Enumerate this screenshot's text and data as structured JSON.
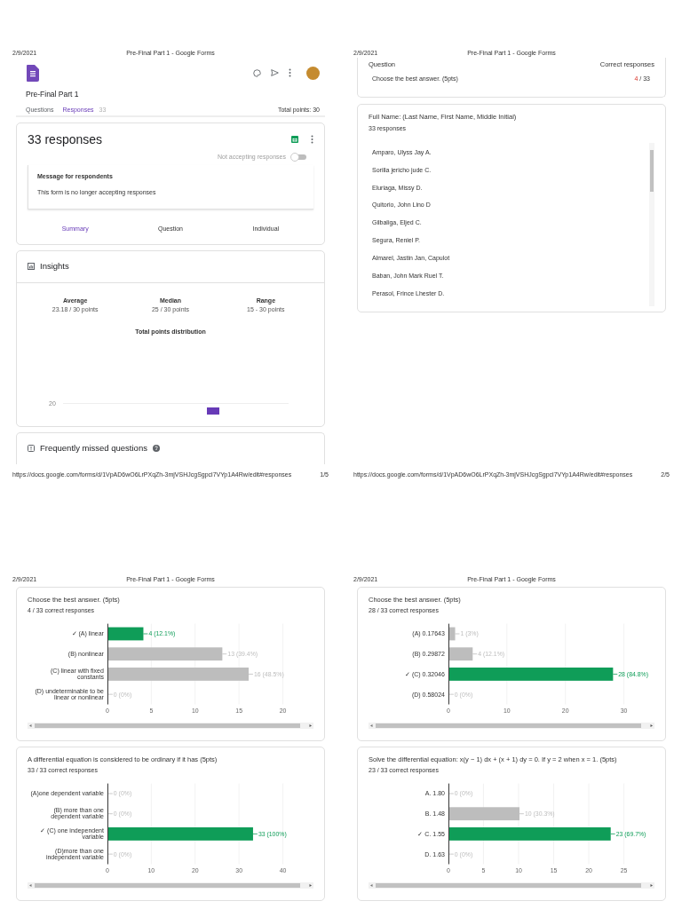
{
  "pages": [
    {
      "kind": "summary",
      "header": {
        "date": "2/9/2021",
        "title": "Pre-Final Part 1 - Google Forms"
      },
      "footer": {
        "url": "https://docs.google.com/forms/d/1VpAD6wO6LrPXqZh-3mjVSHJcgSgpcl7VYp1A4Rw/edit#responses",
        "page": "1/5"
      },
      "form_title": "Pre-Final Part 1",
      "tabs": [
        {
          "label": "Questions",
          "selected": false
        },
        {
          "label": "Responses",
          "selected": true,
          "count": "33"
        }
      ],
      "total_points": "Total points: 30",
      "responses_card": {
        "title": "33 responses",
        "accepting_label": "Not accepting responses",
        "accepting": false,
        "message_title": "Message for respondents",
        "message": "This form is no longer accepting responses",
        "view_tabs": [
          {
            "label": "Summary",
            "selected": true
          },
          {
            "label": "Question",
            "selected": false
          },
          {
            "label": "Individual",
            "selected": false
          }
        ]
      },
      "insights": {
        "title": "Insights",
        "stats": [
          {
            "label": "Average",
            "value": "23.18 / 30 points"
          },
          {
            "label": "Median",
            "value": "25 / 30 points"
          },
          {
            "label": "Range",
            "value": "15 - 30 points"
          }
        ],
        "distribution_title": "Total points distribution",
        "tick": "20"
      },
      "missed": {
        "title": "Frequently missed questions"
      }
    },
    {
      "kind": "list",
      "header": {
        "date": "2/9/2021",
        "title": "Pre-Final Part 1 - Google Forms"
      },
      "footer": {
        "url": "https://docs.google.com/forms/d/1VpAD6wO6LrPXqZh-3mjVSHJcgSgpcl7VYp1A4Rw/edit#responses",
        "page": "2/5"
      },
      "missed_table": {
        "columns": [
          "Question",
          "Correct responses"
        ],
        "rows": [
          {
            "question": "Choose the best answer. (5pts)",
            "correct": "4",
            "total": " / 33"
          }
        ]
      },
      "text_question": {
        "title": "Full Name: (Last Name, First Name, Middle Initial)",
        "count": "33 responses",
        "answers": [
          "Amparo, Ulyss Jay A.",
          "Sorilla jericho jude C.",
          "Eluriaga, Missy D.",
          "Quitorio, John Lino D",
          "Gilbaliga, Eljed C.",
          "Segura, Reniel P.",
          "Almarel, Jastin Jan, Capulot",
          "Baban, John Mark Ruel T.",
          "Perasol, Frince Lhester D."
        ]
      }
    },
    {
      "kind": "charts",
      "header": {
        "date": "2/9/2021",
        "title": "Pre-Final Part 1 - Google Forms"
      },
      "questions": [
        {
          "title": "Choose the best answer. (5pts)",
          "correct_count": "4 / 33 correct responses",
          "chart_data": {
            "type": "bar",
            "orientation": "horizontal",
            "xlim": [
              0,
              20
            ],
            "grid": true,
            "categories": [
              "✓ (A) linear",
              "(B) nonlinear",
              "(C) linear with fixed constants",
              "(D) undeterminable to be linear or nonlinear"
            ],
            "series": [
              {
                "color": "#0f9d58",
                "values": [
                  4,
                  null,
                  null,
                  null
                ]
              },
              {
                "color": "#bdbdbd",
                "values": [
                  null,
                  13,
                  16,
                  0
                ]
              }
            ],
            "value_labels": [
              "4 (12.1%)",
              "13 (39.4%)",
              "16 (48.5%)",
              "0 (0%)"
            ],
            "xticks": [
              0,
              5,
              10,
              15,
              20
            ]
          }
        },
        {
          "title": "A differential equation is considered to be ordinary if it has (5pts)",
          "correct_count": "33 / 33 correct responses",
          "chart_data": {
            "type": "bar",
            "orientation": "horizontal",
            "xlim": [
              0,
              40
            ],
            "grid": true,
            "categories": [
              "(A)one dependent variable",
              "(B) more than one dependent variable",
              "✓ (C) one independent variable",
              "(D)more than one independent variable"
            ],
            "series": [
              {
                "color": "#0f9d58",
                "values": [
                  null,
                  null,
                  33,
                  null
                ]
              },
              {
                "color": "#bdbdbd",
                "values": [
                  0,
                  0,
                  null,
                  0
                ]
              }
            ],
            "value_labels": [
              "0 (0%)",
              "0 (0%)",
              "33 (100%)",
              "0 (0%)"
            ],
            "xticks": [
              0,
              10,
              20,
              30,
              40
            ]
          }
        }
      ]
    },
    {
      "kind": "charts",
      "header": {
        "date": "2/9/2021",
        "title": "Pre-Final Part 1 - Google Forms"
      },
      "questions": [
        {
          "title": "Choose the best answer. (5pts)",
          "correct_count": "28 / 33 correct responses",
          "chart_data": {
            "type": "bar",
            "orientation": "horizontal",
            "xlim": [
              0,
              30
            ],
            "grid": true,
            "categories": [
              "(A) 0.17643",
              "(B) 0.29872",
              "✓ (C) 0.32046",
              "(D) 0.58024"
            ],
            "series": [
              {
                "color": "#0f9d58",
                "values": [
                  null,
                  null,
                  28,
                  null
                ]
              },
              {
                "color": "#bdbdbd",
                "values": [
                  1,
                  4,
                  null,
                  0
                ]
              }
            ],
            "value_labels": [
              "1 (3%)",
              "4 (12.1%)",
              "28 (84.8%)",
              "0 (0%)"
            ],
            "xticks": [
              0,
              10,
              20,
              30
            ]
          }
        },
        {
          "title": "Solve the differential equation: x(y − 1) dx + (x + 1) dy = 0. If y = 2 when x = 1. (5pts)",
          "correct_count": "23 / 33 correct responses",
          "chart_data": {
            "type": "bar",
            "orientation": "horizontal",
            "xlim": [
              0,
              25
            ],
            "grid": true,
            "categories": [
              "A. 1.80",
              "B. 1.48",
              "✓ C. 1.55",
              "D. 1.63"
            ],
            "series": [
              {
                "color": "#0f9d58",
                "values": [
                  null,
                  null,
                  23,
                  null
                ]
              },
              {
                "color": "#bdbdbd",
                "values": [
                  0,
                  10,
                  null,
                  0
                ]
              }
            ],
            "value_labels": [
              "0 (0%)",
              "10 (30.3%)",
              "23 (69.7%)",
              "0 (0%)"
            ],
            "xticks": [
              0,
              5,
              10,
              15,
              20,
              25
            ]
          }
        }
      ]
    }
  ]
}
